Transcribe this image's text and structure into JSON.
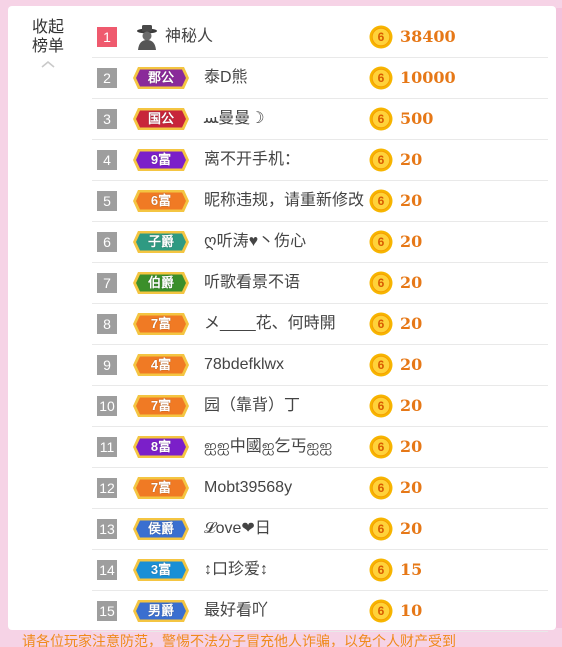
{
  "collapse": {
    "line1": "收起",
    "line2": "榜单"
  },
  "footer_text": "请各位玩家注意防范，警惕不法分子冒充他人诈骗，以免个人财产受到",
  "coin_glyph": "6",
  "rows": [
    {
      "rank": "1",
      "badge": "",
      "badge_color": "",
      "name": "神秘人",
      "amount": "38400",
      "avatar": "mystery-avatar-icon"
    },
    {
      "rank": "2",
      "badge": "郡公",
      "badge_color": "#8a2a9a",
      "name": "泰D熊",
      "amount": "10000"
    },
    {
      "rank": "3",
      "badge": "国公",
      "badge_color": "#c8253a",
      "name": "ﺴ曼曼☽",
      "amount": "500"
    },
    {
      "rank": "4",
      "badge": "9富",
      "badge_color": "#7b1fc9",
      "name": "离不开手机：",
      "amount": "20"
    },
    {
      "rank": "5",
      "badge": "6富",
      "badge_color": "#f07a24",
      "name": "昵称违规，请重新修改",
      "amount": "20"
    },
    {
      "rank": "6",
      "badge": "子爵",
      "badge_color": "#2f9a82",
      "name": "ღ听涛♥丶伤心",
      "amount": "20"
    },
    {
      "rank": "7",
      "badge": "伯爵",
      "badge_color": "#3b8f2a",
      "name": "听歌看景不语",
      "amount": "20"
    },
    {
      "rank": "8",
      "badge": "7富",
      "badge_color": "#f07a24",
      "name": "メ____花、何時開",
      "amount": "20"
    },
    {
      "rank": "9",
      "badge": "4富",
      "badge_color": "#f07a24",
      "name": "78bdefklwx",
      "amount": "20"
    },
    {
      "rank": "10",
      "badge": "7富",
      "badge_color": "#f07a24",
      "name": "园（靠背）丁",
      "amount": "20"
    },
    {
      "rank": "11",
      "badge": "8富",
      "badge_color": "#7b1fc9",
      "name": "ஐஐ中國ஐ乞丐ஐஐ",
      "amount": "20"
    },
    {
      "rank": "12",
      "badge": "7富",
      "badge_color": "#f07a24",
      "name": "Mobt39568y",
      "amount": "20"
    },
    {
      "rank": "13",
      "badge": "侯爵",
      "badge_color": "#3a6fd0",
      "name": "𝓛ove❤日",
      "amount": "20"
    },
    {
      "rank": "14",
      "badge": "3富",
      "badge_color": "#1a8fd6",
      "name": "↕口珍爱↕",
      "amount": "15"
    },
    {
      "rank": "15",
      "badge": "男爵",
      "badge_color": "#3a6fd0",
      "name": "最好看吖",
      "amount": "10"
    }
  ]
}
